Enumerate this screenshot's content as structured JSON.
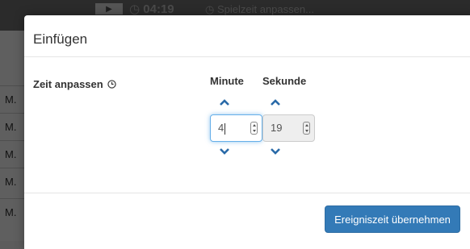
{
  "background": {
    "timer": "04:19",
    "adjust_label": "Spielzeit anpassen...",
    "row_labels": [
      "M.",
      "M.",
      "M.",
      "M.",
      "M."
    ]
  },
  "modal": {
    "title": "Einfügen",
    "field_label": "Zeit anpassen",
    "minute_label": "Minute",
    "second_label": "Sekunde",
    "minute_value": "4",
    "second_value": "19",
    "submit_label": "Ereigniszeit übernehmen"
  },
  "colors": {
    "primary": "#337ab7",
    "chevron": "#2a6aa8",
    "focus": "#66afe9"
  },
  "icons": [
    "play-icon",
    "clock-icon",
    "chevron-up-icon",
    "chevron-down-icon",
    "spinner-icon"
  ]
}
